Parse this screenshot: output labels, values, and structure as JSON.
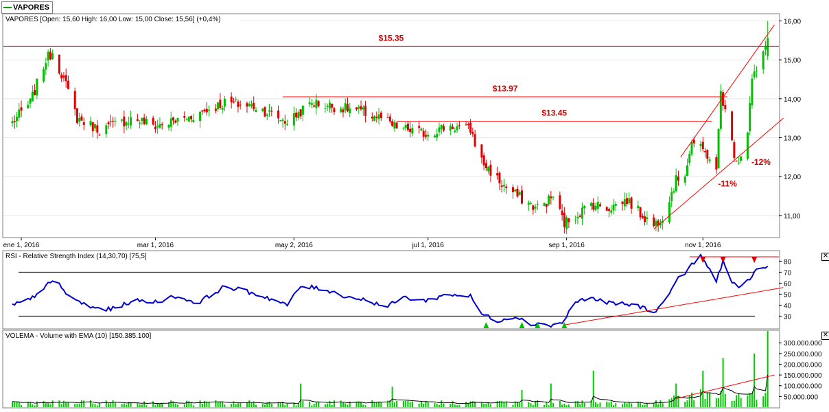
{
  "tab": {
    "label": "VAPORES"
  },
  "price_panel": {
    "title": "VAPORES [Open: 15,60  High: 16,00  Low: 15,00  Close: 15,56] (+0,4%)"
  },
  "rsi_panel": {
    "title": "RSI - Relative Strength Index (14,30,70) [75,5]"
  },
  "vol_panel": {
    "title": "VOLEMA - Volume with EMA (10) [150.385.100]"
  },
  "icons": {
    "close": "close-icon",
    "marker_up": "triangle-up-icon",
    "marker_down": "triangle-down-icon"
  },
  "colors": {
    "up": "#00c000",
    "down": "#e00000",
    "line": "#0000cc",
    "annot": "#cc0000",
    "trend": "#ff0000",
    "ema": "#000000",
    "vol": "#00cc00"
  },
  "chart_data": [
    {
      "type": "candlestick",
      "name": "VAPORES",
      "x_tick_labels": [
        "ene 1, 2016",
        "mar 1, 2016",
        "may 2, 2016",
        "jul 1, 2016",
        "sep 1, 2016",
        "nov 1, 2016"
      ],
      "y_tick_labels": [
        "16,00",
        "15,00",
        "14,00",
        "13,00",
        "12,00",
        "11,00"
      ],
      "ylim": [
        10.45,
        16.15
      ],
      "x_range": [
        "2015-12-24",
        "2016-12-05"
      ],
      "ohlc_last": {
        "open": 15.6,
        "high": 16.0,
        "low": 15.0,
        "close": 15.56,
        "change": "+0,4%"
      },
      "anchors": [
        [
          "2015-12-28",
          13.4
        ],
        [
          "2016-01-05",
          13.9
        ],
        [
          "2016-01-12",
          15.0
        ],
        [
          "2016-01-15",
          15.2
        ],
        [
          "2016-01-20",
          14.5
        ],
        [
          "2016-01-26",
          13.5
        ],
        [
          "2016-02-05",
          13.2
        ],
        [
          "2016-02-20",
          13.5
        ],
        [
          "2016-03-01",
          13.3
        ],
        [
          "2016-03-15",
          13.5
        ],
        [
          "2016-04-01",
          13.9
        ],
        [
          "2016-04-15",
          13.8
        ],
        [
          "2016-04-29",
          13.4
        ],
        [
          "2016-05-10",
          13.9
        ],
        [
          "2016-05-30",
          13.7
        ],
        [
          "2016-06-10",
          13.5
        ],
        [
          "2016-06-15",
          13.3
        ],
        [
          "2016-06-30",
          13.1
        ],
        [
          "2016-07-10",
          13.3
        ],
        [
          "2016-07-20",
          13.2
        ],
        [
          "2016-07-25",
          12.4
        ],
        [
          "2016-08-03",
          11.8
        ],
        [
          "2016-08-10",
          11.5
        ],
        [
          "2016-08-18",
          11.2
        ],
        [
          "2016-08-22",
          11.3
        ],
        [
          "2016-08-26",
          11.5
        ],
        [
          "2016-08-31",
          10.8
        ],
        [
          "2016-09-05",
          11.0
        ],
        [
          "2016-09-12",
          11.3
        ],
        [
          "2016-09-20",
          11.2
        ],
        [
          "2016-09-28",
          11.4
        ],
        [
          "2016-10-05",
          11.0
        ],
        [
          "2016-10-10",
          10.75
        ],
        [
          "2016-10-14",
          11.0
        ],
        [
          "2016-10-20",
          11.9
        ],
        [
          "2016-10-24",
          12.1
        ],
        [
          "2016-10-27",
          12.9
        ],
        [
          "2016-10-31",
          12.7
        ],
        [
          "2016-11-04",
          12.5
        ],
        [
          "2016-11-07",
          12.1
        ],
        [
          "2016-11-09",
          14.2
        ],
        [
          "2016-11-12",
          13.4
        ],
        [
          "2016-11-15",
          12.6
        ],
        [
          "2016-11-17",
          12.4
        ],
        [
          "2016-11-21",
          13.2
        ],
        [
          "2016-11-23",
          14.5
        ],
        [
          "2016-11-27",
          14.9
        ],
        [
          "2016-11-30",
          15.56
        ]
      ],
      "annotations": [
        {
          "text": "$15.35",
          "value": 15.35,
          "from": "2015-12-24",
          "to": "2016-12-05"
        },
        {
          "text": "$13.97",
          "value": 14.05,
          "from": "2016-04-27",
          "to": "2016-11-12"
        },
        {
          "text": "$13.45",
          "value": 13.42,
          "from": "2016-06-17",
          "to": "2016-11-05"
        }
      ],
      "pct_labels": [
        {
          "text": "-11%",
          "date": "2016-11-12",
          "value": 11.75
        },
        {
          "text": "-12%",
          "date": "2016-11-27",
          "value": 12.3
        }
      ],
      "trend_lines": [
        {
          "from": [
            "2016-10-10",
            10.65
          ],
          "to": [
            "2016-12-07",
            13.5
          ]
        },
        {
          "from": [
            "2016-10-22",
            12.5
          ],
          "to": [
            "2016-12-03",
            15.9
          ]
        }
      ]
    },
    {
      "type": "line",
      "name": "RSI",
      "y_tick_labels": [
        "80",
        "70",
        "60",
        "50",
        "40",
        "30"
      ],
      "ylim": [
        19,
        89
      ],
      "levels": [
        30,
        70
      ],
      "points": [
        [
          "2015-12-28",
          40
        ],
        [
          "2016-01-05",
          45
        ],
        [
          "2016-01-12",
          58
        ],
        [
          "2016-01-17",
          62
        ],
        [
          "2016-01-22",
          48
        ],
        [
          "2016-02-01",
          38
        ],
        [
          "2016-02-10",
          36
        ],
        [
          "2016-02-20",
          44
        ],
        [
          "2016-03-01",
          43
        ],
        [
          "2016-03-10",
          48
        ],
        [
          "2016-03-20",
          42
        ],
        [
          "2016-04-01",
          57
        ],
        [
          "2016-04-10",
          53
        ],
        [
          "2016-04-20",
          47
        ],
        [
          "2016-04-29",
          40
        ],
        [
          "2016-05-05",
          57
        ],
        [
          "2016-05-15",
          55
        ],
        [
          "2016-05-25",
          48
        ],
        [
          "2016-06-05",
          44
        ],
        [
          "2016-06-12",
          38
        ],
        [
          "2016-06-20",
          47
        ],
        [
          "2016-06-30",
          44
        ],
        [
          "2016-07-10",
          50
        ],
        [
          "2016-07-20",
          48
        ],
        [
          "2016-07-25",
          32
        ],
        [
          "2016-08-01",
          26
        ],
        [
          "2016-08-10",
          30
        ],
        [
          "2016-08-15",
          22
        ],
        [
          "2016-08-20",
          24
        ],
        [
          "2016-08-25",
          21
        ],
        [
          "2016-08-31",
          25
        ],
        [
          "2016-09-03",
          40
        ],
        [
          "2016-09-10",
          47
        ],
        [
          "2016-09-20",
          42
        ],
        [
          "2016-10-01",
          40
        ],
        [
          "2016-10-05",
          38
        ],
        [
          "2016-10-10",
          34
        ],
        [
          "2016-10-14",
          41
        ],
        [
          "2016-10-20",
          62
        ],
        [
          "2016-10-25",
          72
        ],
        [
          "2016-10-31",
          85
        ],
        [
          "2016-11-04",
          72
        ],
        [
          "2016-11-07",
          63
        ],
        [
          "2016-11-10",
          80
        ],
        [
          "2016-11-13",
          64
        ],
        [
          "2016-11-17",
          54
        ],
        [
          "2016-11-21",
          62
        ],
        [
          "2016-11-25",
          72
        ],
        [
          "2016-11-30",
          75.5
        ]
      ],
      "buy_markers": [
        "2016-07-27",
        "2016-08-12",
        "2016-08-19",
        "2016-08-31"
      ],
      "sell_markers": [
        "2016-11-01",
        "2016-11-10",
        "2016-11-24"
      ],
      "resistance": {
        "from": "2016-10-26",
        "to": "2016-12-05",
        "value": 84
      },
      "trend_line": {
        "from": [
          "2016-08-31",
          22
        ],
        "to": [
          "2016-12-07",
          56
        ]
      }
    },
    {
      "type": "bar",
      "name": "VOLEMA",
      "y_tick_labels": [
        "300.000.000",
        "250.000.000",
        "200.000.000",
        "150.000.000",
        "100.000.000",
        "50.000.000"
      ],
      "ylim": [
        0,
        355000000
      ],
      "ema_last": 150385100,
      "spikes": [
        [
          "2016-05-05",
          110000000
        ],
        [
          "2016-06-15",
          95000000
        ],
        [
          "2016-07-23",
          120000000
        ],
        [
          "2016-08-12",
          80000000
        ],
        [
          "2016-08-25",
          110000000
        ],
        [
          "2016-09-13",
          170000000
        ],
        [
          "2016-09-25",
          95000000
        ],
        [
          "2016-10-20",
          110000000
        ],
        [
          "2016-11-01",
          170000000
        ],
        [
          "2016-11-10",
          230000000
        ],
        [
          "2016-11-24",
          250000000
        ],
        [
          "2016-11-30",
          360000000
        ]
      ],
      "trend_line": {
        "from": [
          "2016-10-20",
          40000000
        ],
        "to": [
          "2016-12-03",
          150000000
        ]
      }
    }
  ]
}
